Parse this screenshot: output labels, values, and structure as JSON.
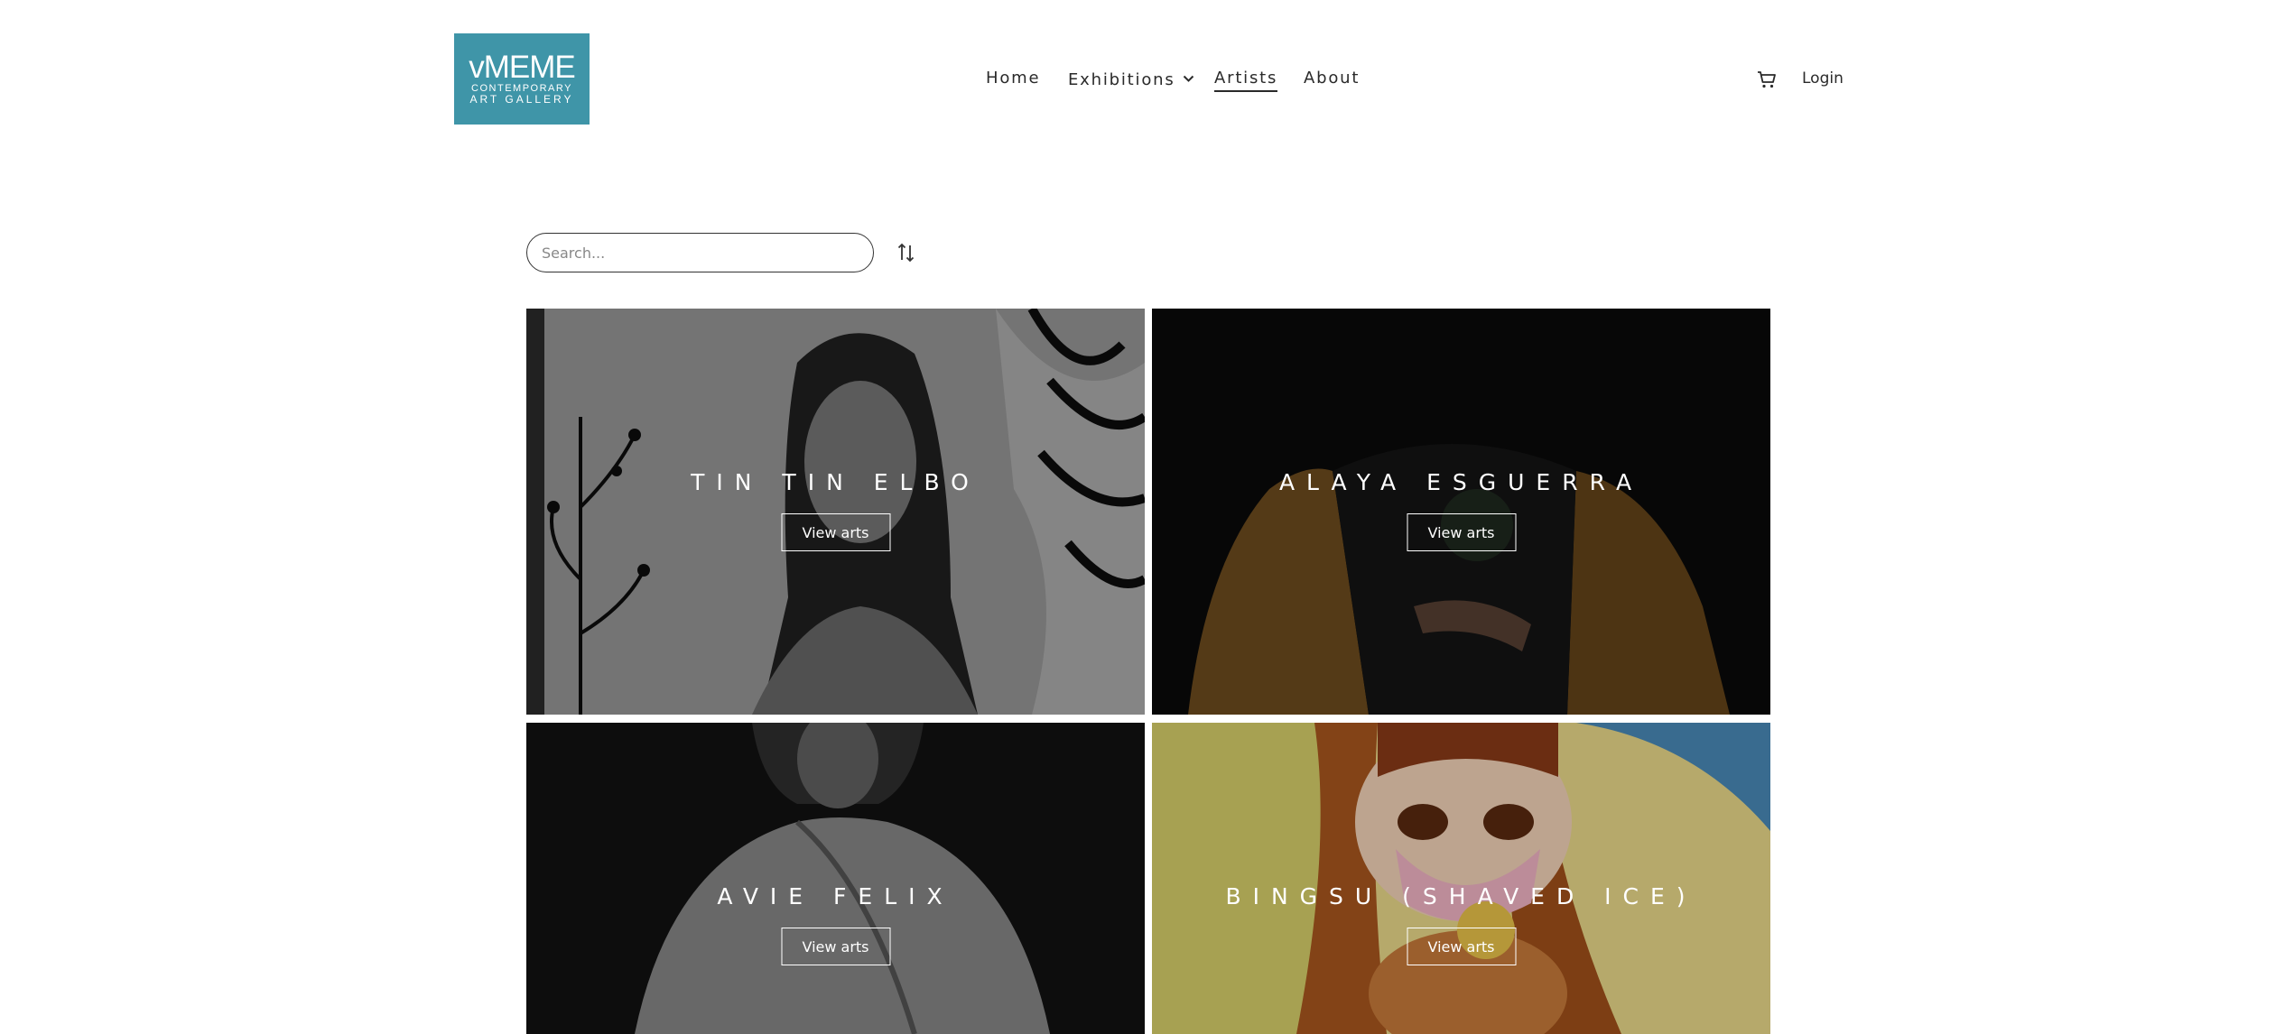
{
  "brand": {
    "logo_main": "vMEME",
    "logo_sub": "CONTEMPORARY",
    "logo_sub2": "ART GALLERY",
    "color": "#3f95a8"
  },
  "nav": {
    "home": "Home",
    "exhibitions": "Exhibitions",
    "artists": "Artists",
    "about": "About",
    "active": "Artists"
  },
  "header_actions": {
    "cart_icon": "cart-icon",
    "login": "Login"
  },
  "search": {
    "placeholder": "Search...",
    "value": "",
    "sort_icon": "sort-icon"
  },
  "artists": [
    {
      "name": "TIN TIN ELBO",
      "button": "View arts"
    },
    {
      "name": "ALAYA ESGUERRA",
      "button": "View arts"
    },
    {
      "name": "AVIE FELIX",
      "button": "View arts"
    },
    {
      "name": "BINGSU (SHAVED ICE)",
      "button": "View arts"
    }
  ]
}
